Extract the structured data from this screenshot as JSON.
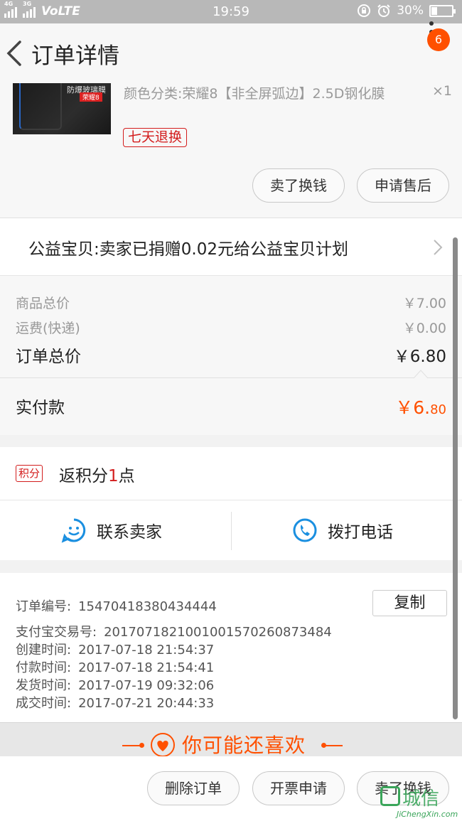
{
  "status_bar": {
    "network1": "4G",
    "network2": "3G",
    "volte": "VoLTE",
    "time": "19:59",
    "battery": "30%",
    "battery_level": 0.3
  },
  "header": {
    "title": "订单详情",
    "badge_count": "6"
  },
  "product": {
    "image_text_1": "防爆玻璃膜",
    "image_text_2": "荣耀8",
    "spec": "颜色分类:荣耀8【非全屏弧边】2.5D钢化膜",
    "quantity": "×1",
    "tag": "七天退换",
    "actions": [
      "卖了换钱",
      "申请售后"
    ]
  },
  "charity": {
    "text": "公益宝贝:卖家已捐赠0.02元给公益宝贝计划"
  },
  "price": {
    "goods_label": "商品总价",
    "goods_value": "￥7.00",
    "shipping_label": "运费(快递)",
    "shipping_value": "￥0.00",
    "total_label": "订单总价",
    "total_value": "￥6.80",
    "paid_label": "实付款",
    "paid_main": "￥6.",
    "paid_cents": "80"
  },
  "points": {
    "tag": "积分",
    "prefix": "返积分",
    "num": "1",
    "suffix": "点"
  },
  "contact": {
    "seller_label": "联系卖家",
    "phone_label": "拨打电话"
  },
  "order_info": {
    "copy_label": "复制",
    "rows": [
      {
        "label": "订单编号:",
        "value": "15470418380434444"
      },
      {
        "label": "支付宝交易号:",
        "value": "2017071821001001570260873484"
      },
      {
        "label": "创建时间:",
        "value": "2017-07-18 21:54:37"
      },
      {
        "label": "付款时间:",
        "value": "2017-07-18 21:54:41"
      },
      {
        "label": "发货时间:",
        "value": "2017-07-19 09:32:06"
      },
      {
        "label": "成交时间:",
        "value": "2017-07-21 20:44:33"
      }
    ]
  },
  "recommend": {
    "title": "你可能还喜欢"
  },
  "bottom_bar": {
    "actions": [
      "删除订单",
      "开票申请",
      "卖了换钱"
    ]
  },
  "watermark": {
    "cn": "城信",
    "en": "JiChengXin.com"
  },
  "colors": {
    "accent": "#ff5000",
    "red": "#d31d1d",
    "contact_blue": "#1a8fe0"
  }
}
